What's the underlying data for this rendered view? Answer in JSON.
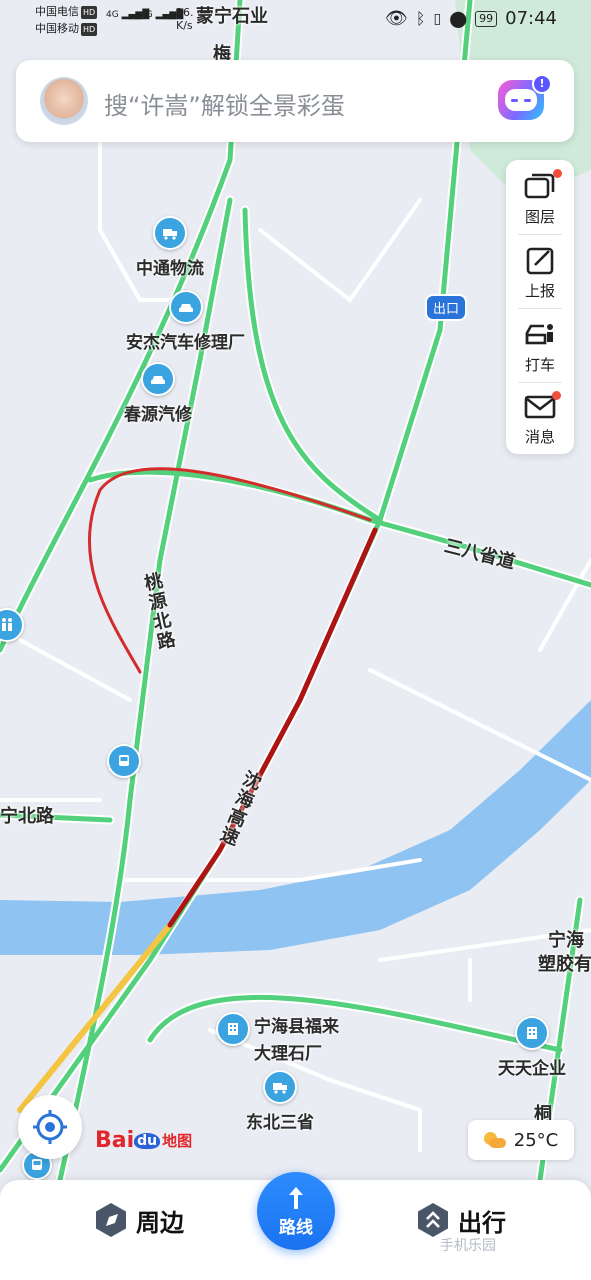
{
  "status_bar": {
    "carrier1": "中国电信",
    "carrier2": "中国移动",
    "hd": "HD",
    "net1": "4G",
    "net2": "4G",
    "speed_value": "26.",
    "speed_unit": "K/s",
    "battery": "99",
    "time": "07:44"
  },
  "search": {
    "placeholder": "搜“许嵩”解锁全景彩蛋",
    "badge": "!"
  },
  "toolbar": {
    "layers": "图层",
    "report": "上报",
    "taxi": "打车",
    "messages": "消息"
  },
  "map": {
    "labels": {
      "top_company": "蒙宁石业",
      "mei": "梅",
      "exit": "出口",
      "road_sanba": "三八省道",
      "road_taoyuan": "桃源北路",
      "road_ning_north": "宁北路",
      "road_shenhai": "沈海高速",
      "road_tong": "桐路",
      "ninghai_plastics_1": "宁海",
      "ninghai_plastics_2": "塑胶有"
    },
    "pois": {
      "zhongtong": "中通物流",
      "anjie": "安杰汽车修理厂",
      "chunyuan": "春源汽修",
      "fulai_1": "宁海县福来",
      "fulai_2": "大理石厂",
      "tiantian": "天天企业",
      "dongbei": "东北三省"
    }
  },
  "weather": {
    "temp": "25°C"
  },
  "logo": {
    "bai": "Bai",
    "du": "du",
    "map": "地图"
  },
  "bottom_bar": {
    "nearby": "周边",
    "route": "路线",
    "travel": "出行"
  },
  "watermark": "手机乐园"
}
